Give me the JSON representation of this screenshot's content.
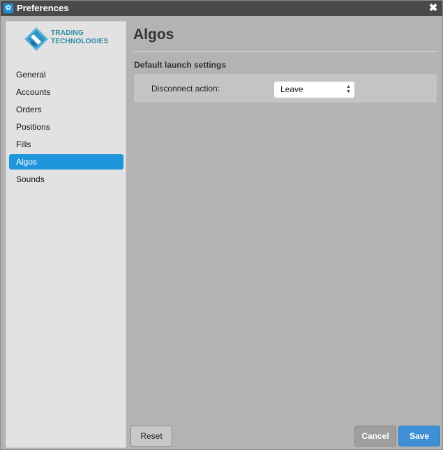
{
  "window": {
    "title": "Preferences",
    "close_glyph": "✖",
    "app_icon": "gear-icon"
  },
  "brand": {
    "line1": "TRADING",
    "line2": "TECHNOLOGIES"
  },
  "sidebar": {
    "items": [
      {
        "label": "General"
      },
      {
        "label": "Accounts"
      },
      {
        "label": "Orders"
      },
      {
        "label": "Positions"
      },
      {
        "label": "Fills"
      },
      {
        "label": "Algos",
        "active": true
      },
      {
        "label": "Sounds"
      }
    ]
  },
  "main": {
    "title": "Algos",
    "section_title": "Default launch settings",
    "setting": {
      "label": "Disconnect action:",
      "value": "Leave"
    }
  },
  "footer": {
    "reset_label": "Reset",
    "cancel_label": "Cancel",
    "save_label": "Save"
  },
  "colors": {
    "accent": "#1f96dc",
    "save_button": "#3f8fd6",
    "titlebar": "#4a4a4a",
    "background": "#b3b3b3"
  }
}
